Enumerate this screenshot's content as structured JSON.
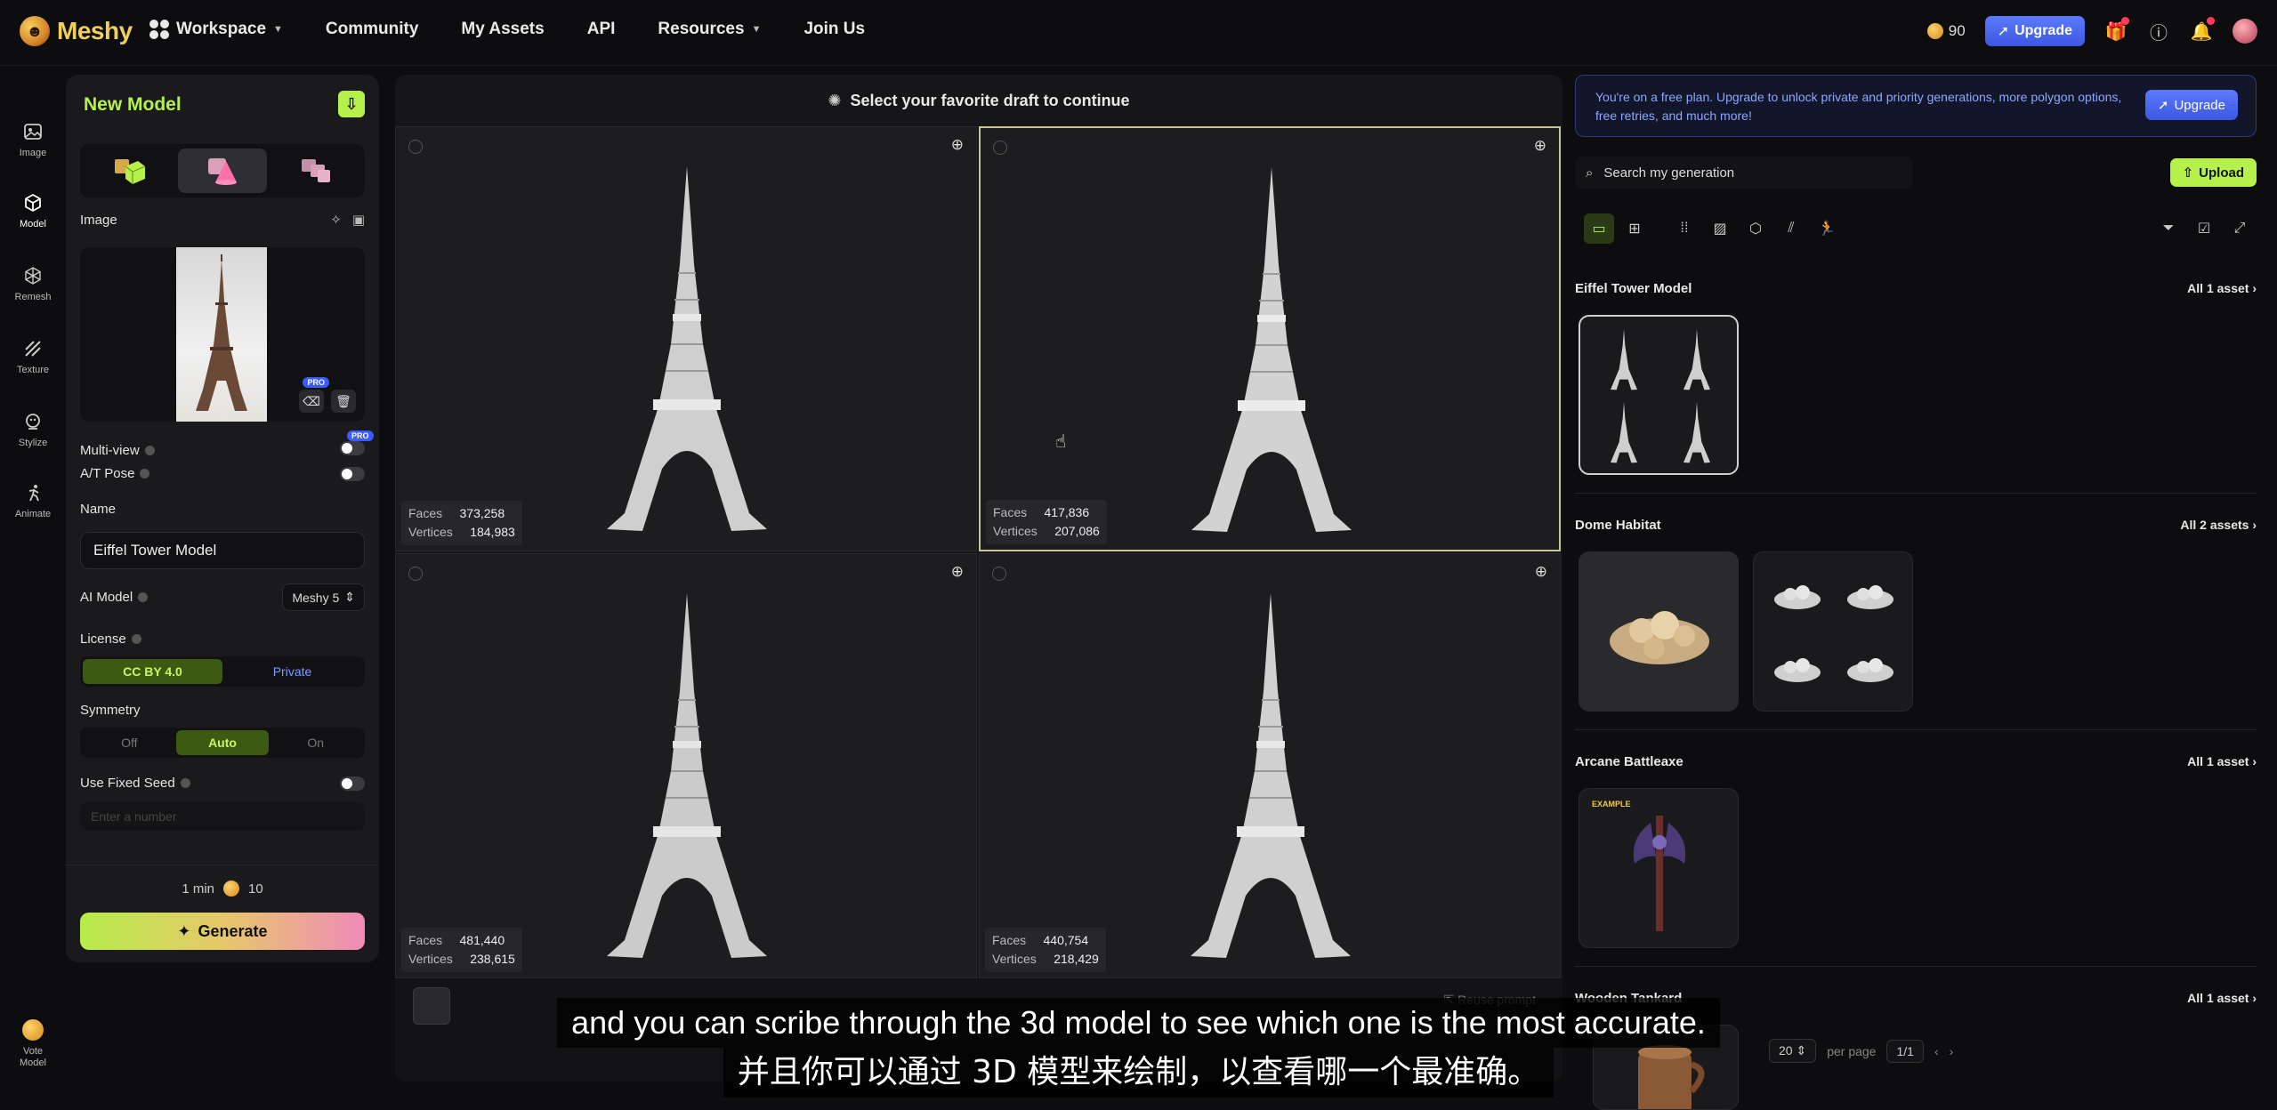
{
  "app": {
    "name": "Meshy"
  },
  "topnav": {
    "items": [
      {
        "label": "Workspace",
        "has_caret": true
      },
      {
        "label": "Community"
      },
      {
        "label": "My Assets"
      },
      {
        "label": "API"
      },
      {
        "label": "Resources",
        "has_caret": true
      },
      {
        "label": "Join Us"
      }
    ],
    "credits": "90",
    "upgrade_label": "Upgrade"
  },
  "rail": [
    {
      "label": "Image",
      "icon": "image-icon"
    },
    {
      "label": "Model",
      "icon": "cube-icon",
      "active": true
    },
    {
      "label": "Remesh",
      "icon": "remesh-icon"
    },
    {
      "label": "Texture",
      "icon": "texture-icon"
    },
    {
      "label": "Stylize",
      "icon": "stylize-icon"
    },
    {
      "label": "Animate",
      "icon": "animate-icon"
    }
  ],
  "rail_bottom": {
    "label": "Vote Model"
  },
  "left_panel": {
    "title": "New Model",
    "image_label": "Image",
    "pro_badge": "PRO",
    "multiview_label": "Multi-view",
    "atpose_label": "A/T Pose",
    "name_label": "Name",
    "name_value": "Eiffel Tower Model",
    "ai_model_label": "AI Model",
    "ai_model_value": "Meshy 5",
    "license_label": "License",
    "license_options": [
      "CC BY 4.0",
      "Private"
    ],
    "symmetry_label": "Symmetry",
    "symmetry_options": [
      "Off",
      "Auto",
      "On"
    ],
    "fixed_seed_label": "Use Fixed Seed",
    "seed_placeholder": "Enter a number",
    "time": "1 min",
    "cost": "10",
    "generate_label": "Generate"
  },
  "center": {
    "header": "Select your favorite draft to continue",
    "faces_label": "Faces",
    "vertices_label": "Vertices",
    "drafts": [
      {
        "faces": "373,258",
        "vertices": "184,983"
      },
      {
        "faces": "417,836",
        "vertices": "207,086"
      },
      {
        "faces": "481,440",
        "vertices": "238,615"
      },
      {
        "faces": "440,754",
        "vertices": "218,429"
      }
    ],
    "reuse_label": "Reuse prompt"
  },
  "right_panel": {
    "banner_text": "You're on a free plan. Upgrade to unlock private and priority generations, more polygon options, free retries, and much more!",
    "banner_btn": "Upgrade",
    "search_placeholder": "Search my generation",
    "upload_label": "Upload",
    "sections": [
      {
        "title": "Eiffel Tower Model",
        "more": "All 1 asset"
      },
      {
        "title": "Dome Habitat",
        "more": "All 2 assets"
      },
      {
        "title": "Arcane Battleaxe",
        "more": "All 1 asset",
        "tag": "EXAMPLE"
      },
      {
        "title": "Wooden Tankard",
        "more": "All 1 asset"
      }
    ],
    "pager": {
      "per_page": "20",
      "per_page_label": "per page",
      "page": "1/1"
    }
  },
  "subtitles": {
    "en": "and you can scribe through the 3d model to see which one is the most accurate.",
    "zh": "并且你可以通过 3D 模型来绘制，以查看哪一个最准确。"
  },
  "colors": {
    "accent": "#b6f04a",
    "upgrade": "#4a66f0",
    "bg": "#0d0d0f"
  }
}
